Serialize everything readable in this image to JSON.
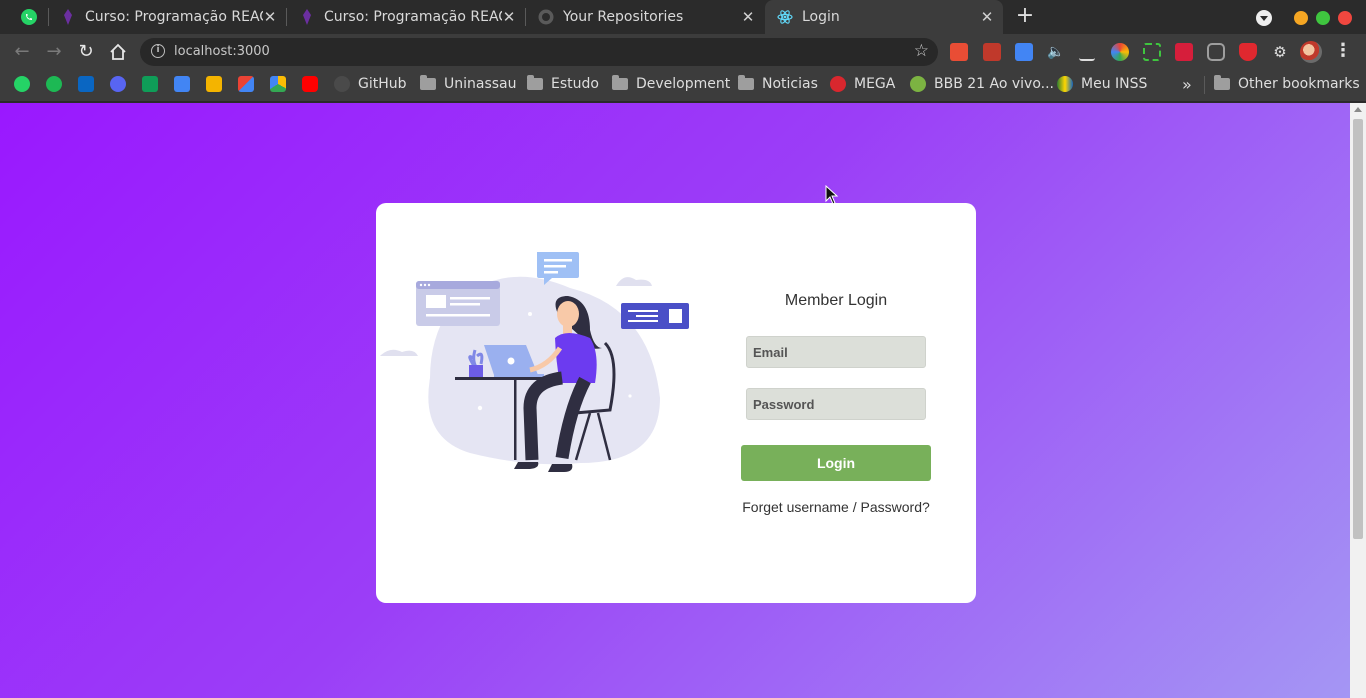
{
  "tabs": [
    {
      "title": "Curso: Programação REACT",
      "close": "✕"
    },
    {
      "title": "Curso: Programação REACT",
      "close": "✕"
    },
    {
      "title": "Your Repositories",
      "close": "✕"
    },
    {
      "title": "Login",
      "close": "✕",
      "active": true
    }
  ],
  "newtab_label": "+",
  "address": {
    "url": "localhost:3000"
  },
  "bookmarks": [
    {
      "label": "GitHub"
    },
    {
      "label": "Uninassau"
    },
    {
      "label": "Estudo"
    },
    {
      "label": "Development"
    },
    {
      "label": "Noticias"
    },
    {
      "label": "MEGA"
    },
    {
      "label": "BBB 21 Ao vivo..."
    },
    {
      "label": "Meu INSS"
    },
    {
      "label": "Other bookmarks"
    }
  ],
  "login": {
    "title": "Member Login",
    "email_placeholder": "Email",
    "password_placeholder": "Password",
    "button": "Login",
    "forget": "Forget username / Password?"
  },
  "colors": {
    "accent_purple": "#9a18ff",
    "login_button": "#78b05a",
    "input_bg": "#dcdfd9"
  }
}
